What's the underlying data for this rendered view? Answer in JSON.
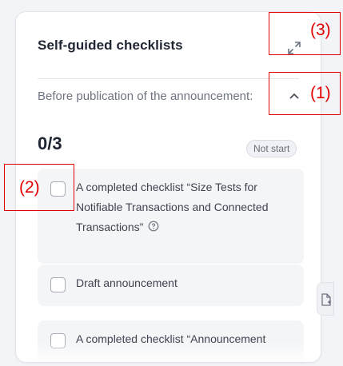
{
  "panel": {
    "title": "Self-guided checklists",
    "section_label": "Before publication of the announcement:",
    "progress": "0/3",
    "status_badge": "Not start"
  },
  "checklist": {
    "items": [
      {
        "label": "A completed checklist “Size Tests for Notifiable Transactions and Connected Transactions”",
        "checked": false,
        "has_info_icon": true
      },
      {
        "label": "Draft announcement",
        "checked": false,
        "has_info_icon": false
      },
      {
        "label": "A completed checklist “Announcement",
        "checked": false,
        "has_info_icon": false
      }
    ]
  },
  "icons": {
    "expand": "expand-icon",
    "collapse": "chevron-up-icon",
    "info": "info-icon",
    "side_tab": "document-icon"
  },
  "annotations": [
    {
      "label": "(3)"
    },
    {
      "label": "(1)"
    },
    {
      "label": "(2)"
    }
  ],
  "colors": {
    "annotation": "#e00000",
    "title": "#1f2533",
    "muted_text": "#6e7380",
    "card_bg": "#f4f5f7"
  }
}
